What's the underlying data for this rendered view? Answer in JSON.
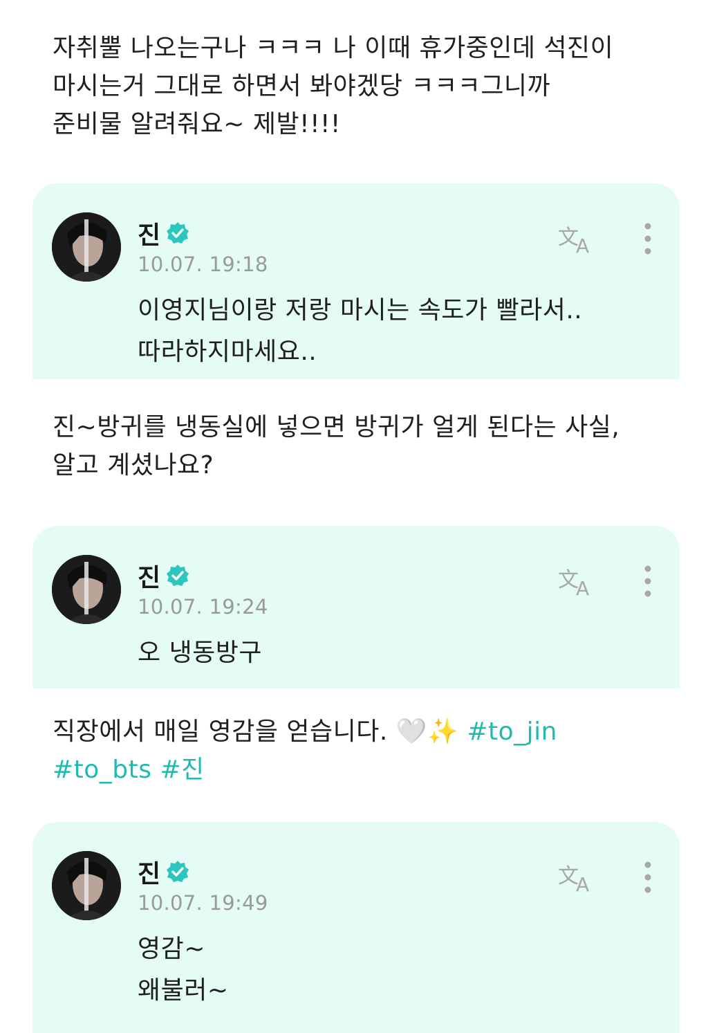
{
  "feed": [
    {
      "post": {
        "lines": [
          "자취뿔 나오는구나 ㅋㅋㅋ 나 이때 휴가중인데 석진이",
          "마시는거 그대로 하면서 봐야겠당 ㅋㅋㅋ그니까",
          "준비물 알려줘요~ 제발!!!!"
        ]
      },
      "reply": {
        "author": "진",
        "timestamp": "10.07. 19:18",
        "lines": [
          "이영지님이랑 저랑 마시는 속도가 빨라서..",
          "따라하지마세요.."
        ]
      }
    },
    {
      "post": {
        "lines": [
          "진~방귀를 냉동실에 넣으면 방귀가 얼게 된다는 사실,",
          "알고 계셨나요?"
        ]
      },
      "reply": {
        "author": "진",
        "timestamp": "10.07. 19:24",
        "lines": [
          "오 냉동방구"
        ]
      }
    },
    {
      "post": {
        "text": "직장에서 매일 영감을 얻습니다. 🤍✨ ",
        "hashtags_line1": "#to_jin",
        "hashtags_line2": "#to_bts #진"
      },
      "reply": {
        "author": "진",
        "timestamp": "10.07. 19:49",
        "lines": [
          "영감~",
          "왜불러~"
        ]
      }
    }
  ],
  "colors": {
    "reply_background": "#e4fbf6",
    "hashtag": "#22b9b0",
    "verified_badge": "#2bc6bd",
    "timestamp": "#9a9a9a"
  },
  "icons": {
    "verified": "verified-badge-icon",
    "translate": "translate-icon",
    "more": "more-vertical-icon"
  }
}
